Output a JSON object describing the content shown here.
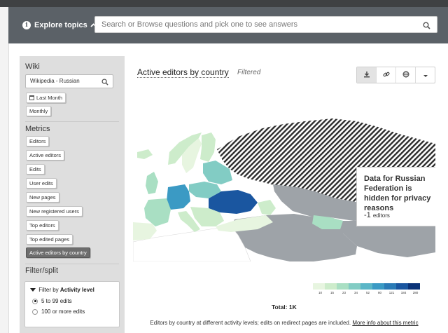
{
  "explore": {
    "label": "Explore topics",
    "search_placeholder": "Search or Browse questions and pick one to see answers"
  },
  "sidebar": {
    "wiki_heading": "Wiki",
    "wiki_value": "Wikipedia - Russian",
    "time_range": "Last Month",
    "granularity": "Monthly",
    "metrics_heading": "Metrics",
    "metrics": [
      "Editors",
      "Active editors",
      "Edits",
      "User edits",
      "New pages",
      "New registered users",
      "Top editors",
      "Top edited pages",
      "Active editors by country"
    ],
    "active_metric": "Active editors by country",
    "filter_heading": "Filter/split",
    "filter": {
      "prefix": "Filter by",
      "field": "Activity level",
      "options": [
        "5 to 99 edits",
        "100 or more edits"
      ],
      "selected": "5 to 99 edits"
    }
  },
  "main": {
    "title": "Active editors by country",
    "filtered_label": "Filtered",
    "tools": [
      {
        "icon": "download-icon"
      },
      {
        "icon": "link-icon"
      },
      {
        "icon": "globe-icon"
      },
      {
        "icon": "caret-down-icon"
      }
    ],
    "tooltip": {
      "text": "Data for Russian Federation is hidden for privacy reasons",
      "value": "-1",
      "unit": "editors"
    },
    "legend": {
      "ticks": [
        "10",
        "15",
        "23",
        "34",
        "52",
        "80",
        "121",
        "184",
        "280"
      ],
      "colors": [
        "#e7f5e0",
        "#cdeccb",
        "#a9dfc3",
        "#82ccc4",
        "#5bb6c7",
        "#3b9ac4",
        "#2b7bb6",
        "#1a56a0",
        "#0b3378"
      ]
    },
    "total": "Total: 1K",
    "caption": "Editors by country at different activity levels; edits on redirect pages are included.",
    "caption_link": "More info about this metric",
    "colors": {
      "no_data": "#9ea3a8",
      "header_bar": "#5b6167",
      "sidebar_bg": "#dedede"
    }
  }
}
